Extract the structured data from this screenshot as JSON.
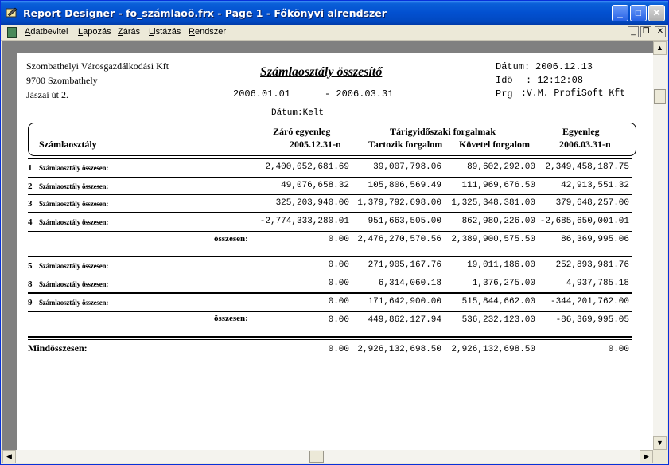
{
  "window": {
    "title": "Report Designer - fo_számlaoö.frx - Page 1 - Főkönyvi alrendszer",
    "minimize_glyph": "_",
    "maximize_glyph": "□",
    "close_glyph": "✕"
  },
  "menu": {
    "items": [
      {
        "label": "Adatbevitel"
      },
      {
        "label": "Lapozás"
      },
      {
        "label": "Zárás"
      },
      {
        "label": "Listázás"
      },
      {
        "label": "Rendszer"
      }
    ],
    "mdi": {
      "minimize": "_",
      "restore": "❐",
      "close": "✕"
    }
  },
  "report": {
    "company": {
      "name": "Szombathelyi Városgazdálkodási Kft",
      "city": "9700 Szombathely",
      "address": "Jászai út 2."
    },
    "title": "Számlaosztály összesítő",
    "period_from": "2006.01.01",
    "period_to": "- 2006.03.31",
    "date_basis": "Dátum:Kelt",
    "meta": {
      "date_label": "Dátum:",
      "date_value": "2006.12.13",
      "time_label": "Idő",
      "time_value": ": 12:12:08",
      "prg_label": "Prg",
      "prg_value": ":V.M. ProfiSoft Kft"
    },
    "headers": {
      "class": "Számlaosztály",
      "closing_1": "Záró egyenleg",
      "closing_2": "2005.12.31-n",
      "period_group": "Tárigyidőszaki forgalmak",
      "debit": "Tartozik forgalom",
      "credit": "Követel forgalom",
      "balance_1": "Egyenleg",
      "balance_2": "2006.03.31-n"
    },
    "rows": [
      {
        "num": "1",
        "label": "Számlaosztály összesen:",
        "closing": "2,400,052,681.69",
        "debit": "39,007,798.06",
        "credit": "89,602,292.00",
        "balance": "2,349,458,187.75"
      },
      {
        "num": "2",
        "label": "Számlaosztály összesen:",
        "closing": "49,076,658.32",
        "debit": "105,806,569.49",
        "credit": "111,969,676.50",
        "balance": "42,913,551.32"
      },
      {
        "num": "3",
        "label": "Számlaosztály összesen:",
        "closing": "325,203,940.00",
        "debit": "1,379,792,698.00",
        "credit": "1,325,348,381.00",
        "balance": "379,648,257.00"
      },
      {
        "num": "4",
        "label": "Számlaosztály összesen:",
        "closing": "-2,774,333,280.01",
        "debit": "951,663,505.00",
        "credit": "862,980,226.00",
        "balance": "-2,685,650,001.01"
      }
    ],
    "subtotal1": {
      "label": "összesen:",
      "closing": "0.00",
      "debit": "2,476,270,570.56",
      "credit": "2,389,900,575.50",
      "balance": "86,369,995.06"
    },
    "rows2": [
      {
        "num": "5",
        "label": "Számlaosztály összesen:",
        "closing": "0.00",
        "debit": "271,905,167.76",
        "credit": "19,011,186.00",
        "balance": "252,893,981.76"
      },
      {
        "num": "8",
        "label": "Számlaosztály összesen:",
        "closing": "0.00",
        "debit": "6,314,060.18",
        "credit": "1,376,275.00",
        "balance": "4,937,785.18"
      },
      {
        "num": "9",
        "label": "Számlaosztály összesen:",
        "closing": "0.00",
        "debit": "171,642,900.00",
        "credit": "515,844,662.00",
        "balance": "-344,201,762.00"
      }
    ],
    "subtotal2": {
      "label": "összesen:",
      "closing": "0.00",
      "debit": "449,862,127.94",
      "credit": "536,232,123.00",
      "balance": "-86,369,995.05"
    },
    "grand": {
      "label": "Mindösszesen:",
      "closing": "0.00",
      "debit": "2,926,132,698.50",
      "credit": "2,926,132,698.50",
      "balance": "0.00"
    }
  },
  "scroll": {
    "up": "▲",
    "down": "▼",
    "left": "◀",
    "right": "▶"
  }
}
